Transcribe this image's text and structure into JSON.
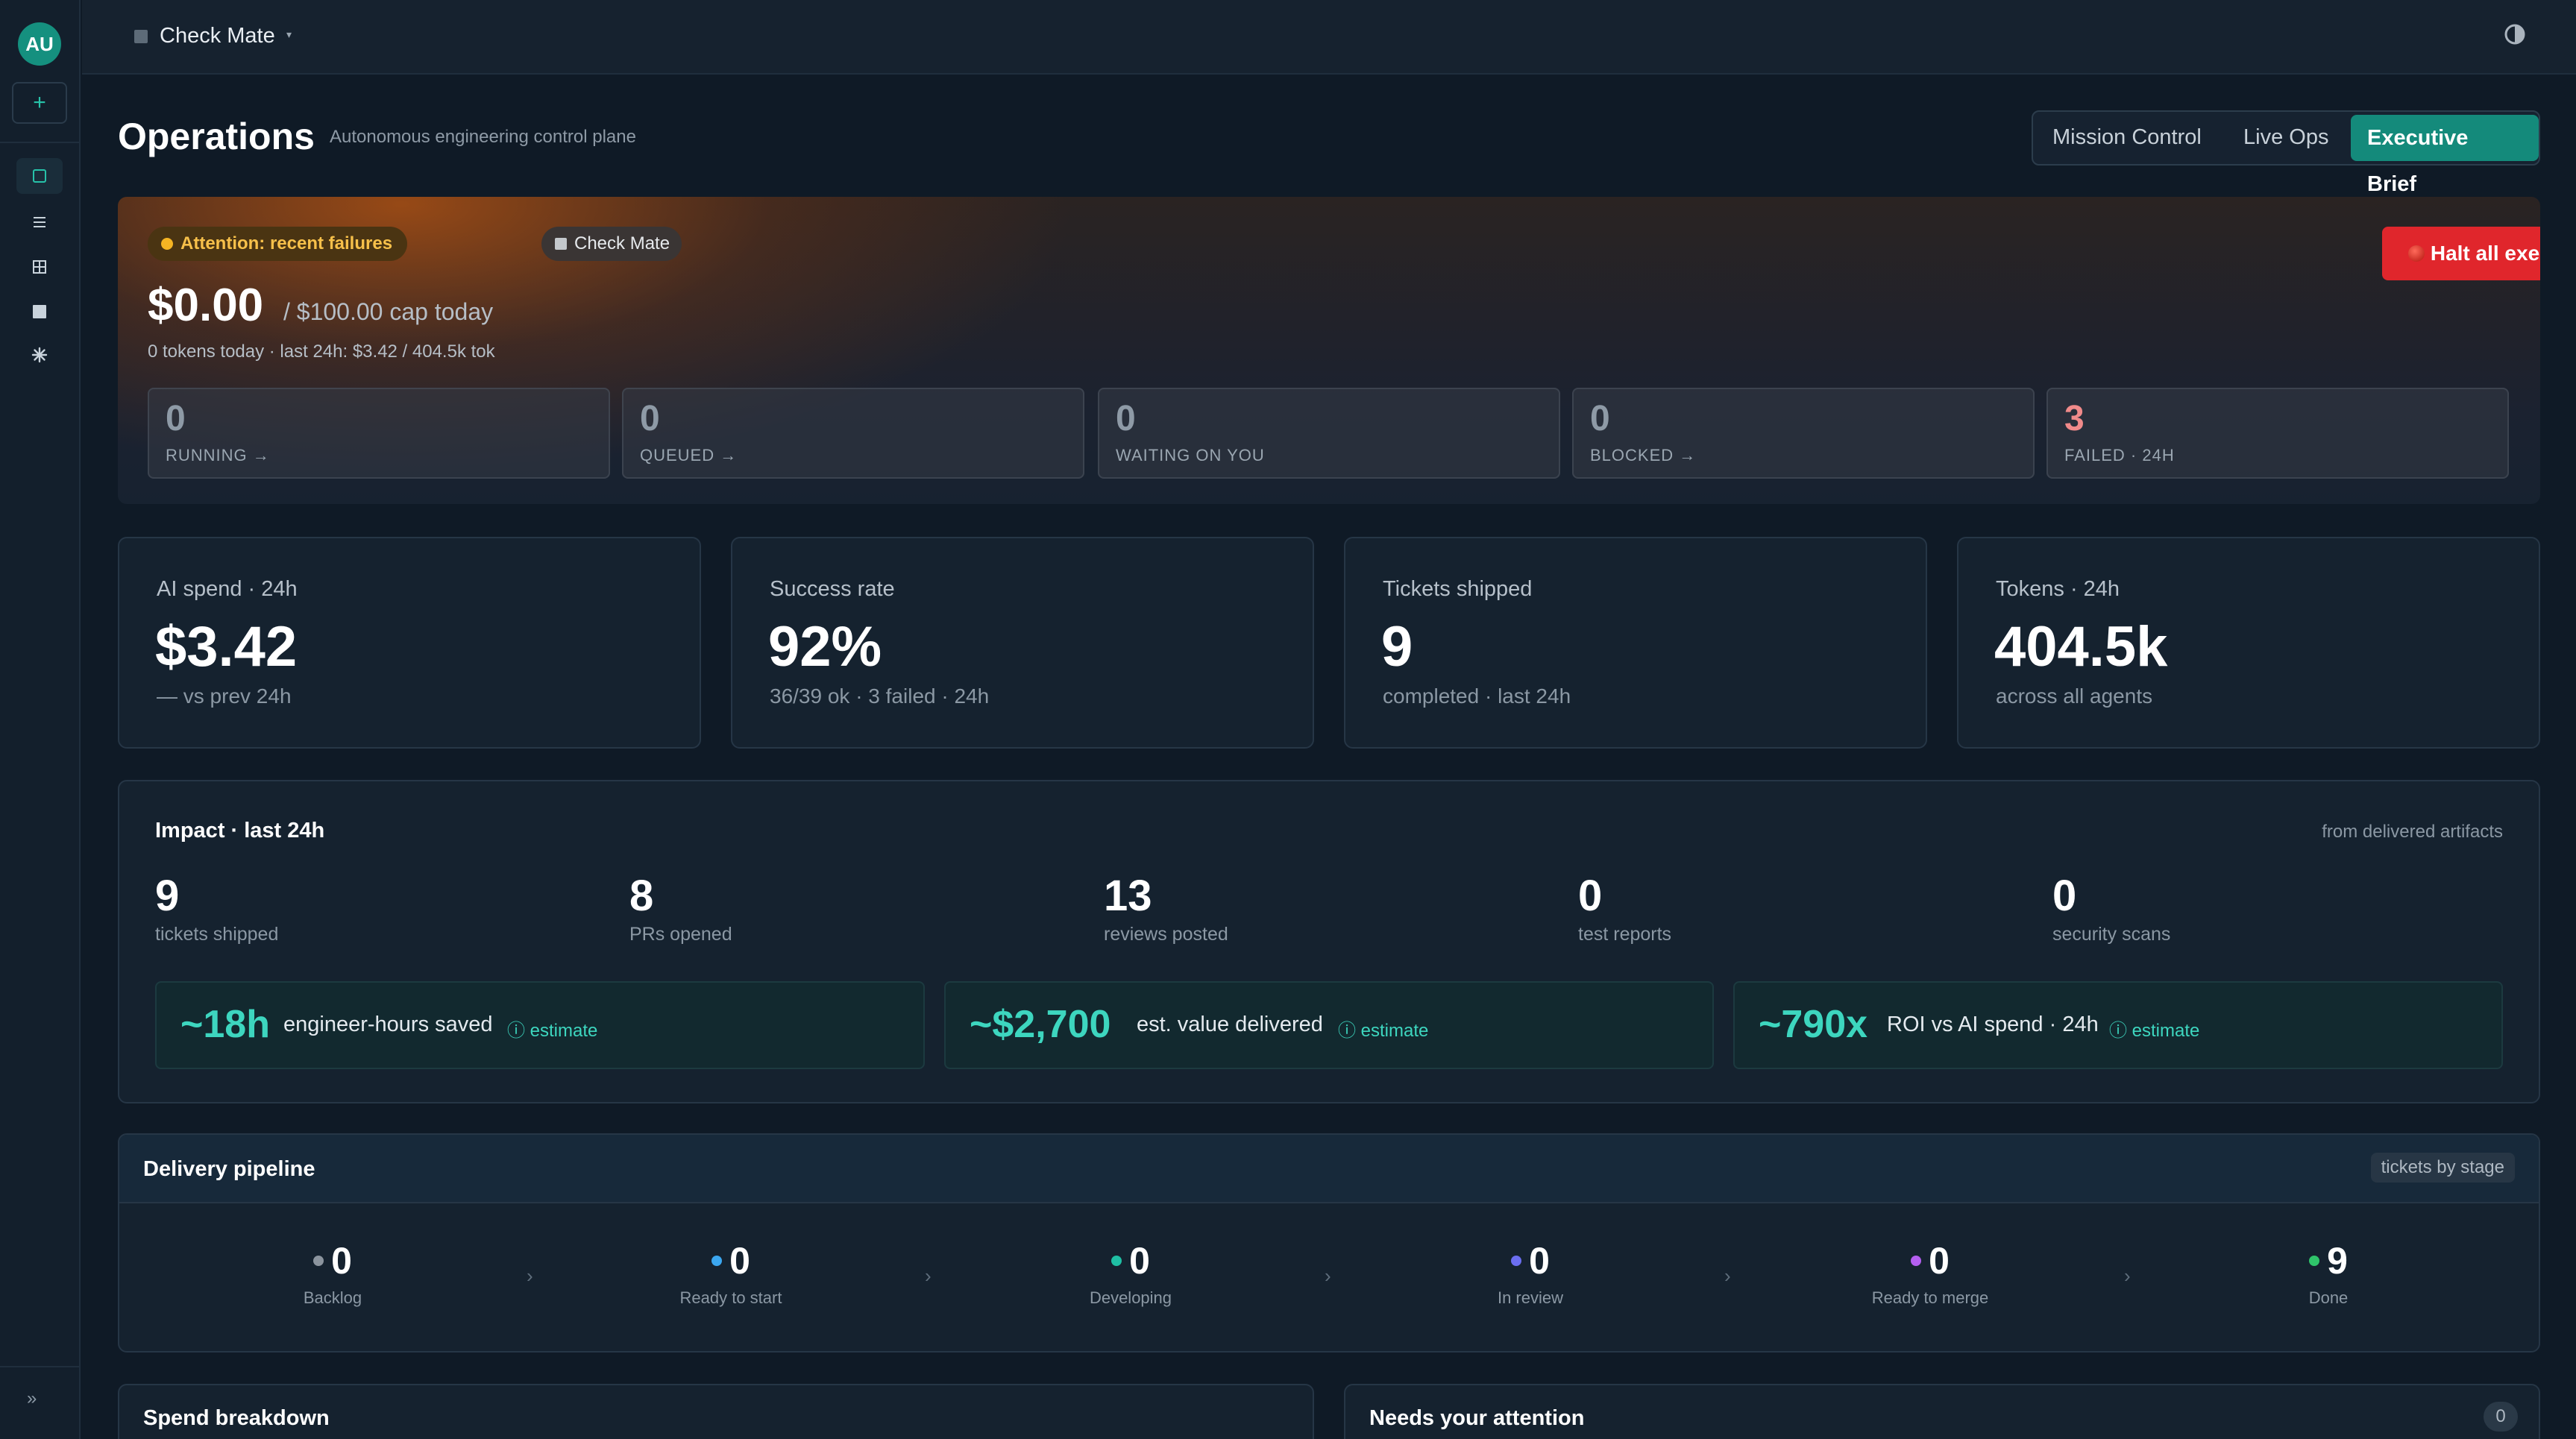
{
  "sidebar": {
    "avatar": "AU",
    "add_label": "+",
    "expand_label": "»"
  },
  "topbar": {
    "workspace": "Check Mate",
    "caret": "▾"
  },
  "header": {
    "title": "Operations",
    "subtitle": "Autonomous engineering control plane",
    "tabs": [
      "Mission Control",
      "Live Ops",
      "Executive Brief"
    ],
    "active_tab": "Executive Brief"
  },
  "hero": {
    "attention": "Attention: recent failures",
    "workspace": "Check Mate",
    "amount": "$0.00",
    "cap": "/ $100.00 cap today",
    "tokens_line": "0 tokens today  ·  last 24h: $3.42 / 404.5k tok",
    "halt_label": "Halt all execution",
    "statuses": [
      {
        "value": "0",
        "label": "RUNNING →"
      },
      {
        "value": "0",
        "label": "QUEUED →"
      },
      {
        "value": "0",
        "label": "WAITING ON YOU"
      },
      {
        "value": "0",
        "label": "BLOCKED →"
      },
      {
        "value": "3",
        "label": "FAILED · 24H"
      }
    ]
  },
  "kpis": [
    {
      "label": "AI spend · 24h",
      "value": "$3.42",
      "sub": "— vs prev 24h"
    },
    {
      "label": "Success rate",
      "value": "92%",
      "sub": "36/39 ok · 3 failed · 24h"
    },
    {
      "label": "Tickets shipped",
      "value": "9",
      "sub": "completed · last 24h"
    },
    {
      "label": "Tokens · 24h",
      "value": "404.5k",
      "sub": "across all agents"
    }
  ],
  "impact": {
    "title": "Impact · last 24h",
    "note": "from delivered artifacts",
    "metrics": [
      {
        "value": "9",
        "label": "tickets shipped"
      },
      {
        "value": "8",
        "label": "PRs opened"
      },
      {
        "value": "13",
        "label": "reviews posted"
      },
      {
        "value": "0",
        "label": "test reports"
      },
      {
        "value": "0",
        "label": "security scans"
      }
    ],
    "estimates": [
      {
        "value": "~18h",
        "label": "engineer-hours saved",
        "tag": "ⓘ estimate"
      },
      {
        "value": "~$2,700",
        "label": "est. value delivered",
        "tag": "ⓘ estimate"
      },
      {
        "value": "~790x",
        "label": "ROI vs AI spend · 24h",
        "tag": "ⓘ estimate"
      }
    ]
  },
  "pipeline": {
    "title": "Delivery pipeline",
    "tag": "tickets by stage",
    "arrow": "›",
    "stages": [
      {
        "value": "0",
        "label": "Backlog",
        "color": "#8b949e"
      },
      {
        "value": "0",
        "label": "Ready to start",
        "color": "#3ba7f0"
      },
      {
        "value": "0",
        "label": "Developing",
        "color": "#1fbfa4"
      },
      {
        "value": "0",
        "label": "In review",
        "color": "#6b6ef0"
      },
      {
        "value": "0",
        "label": "Ready to merge",
        "color": "#b45ff0"
      },
      {
        "value": "9",
        "label": "Done",
        "color": "#2fc46a"
      }
    ]
  },
  "panels": {
    "spend_title": "Spend breakdown",
    "attention_title": "Needs your attention",
    "attention_count": "0"
  }
}
